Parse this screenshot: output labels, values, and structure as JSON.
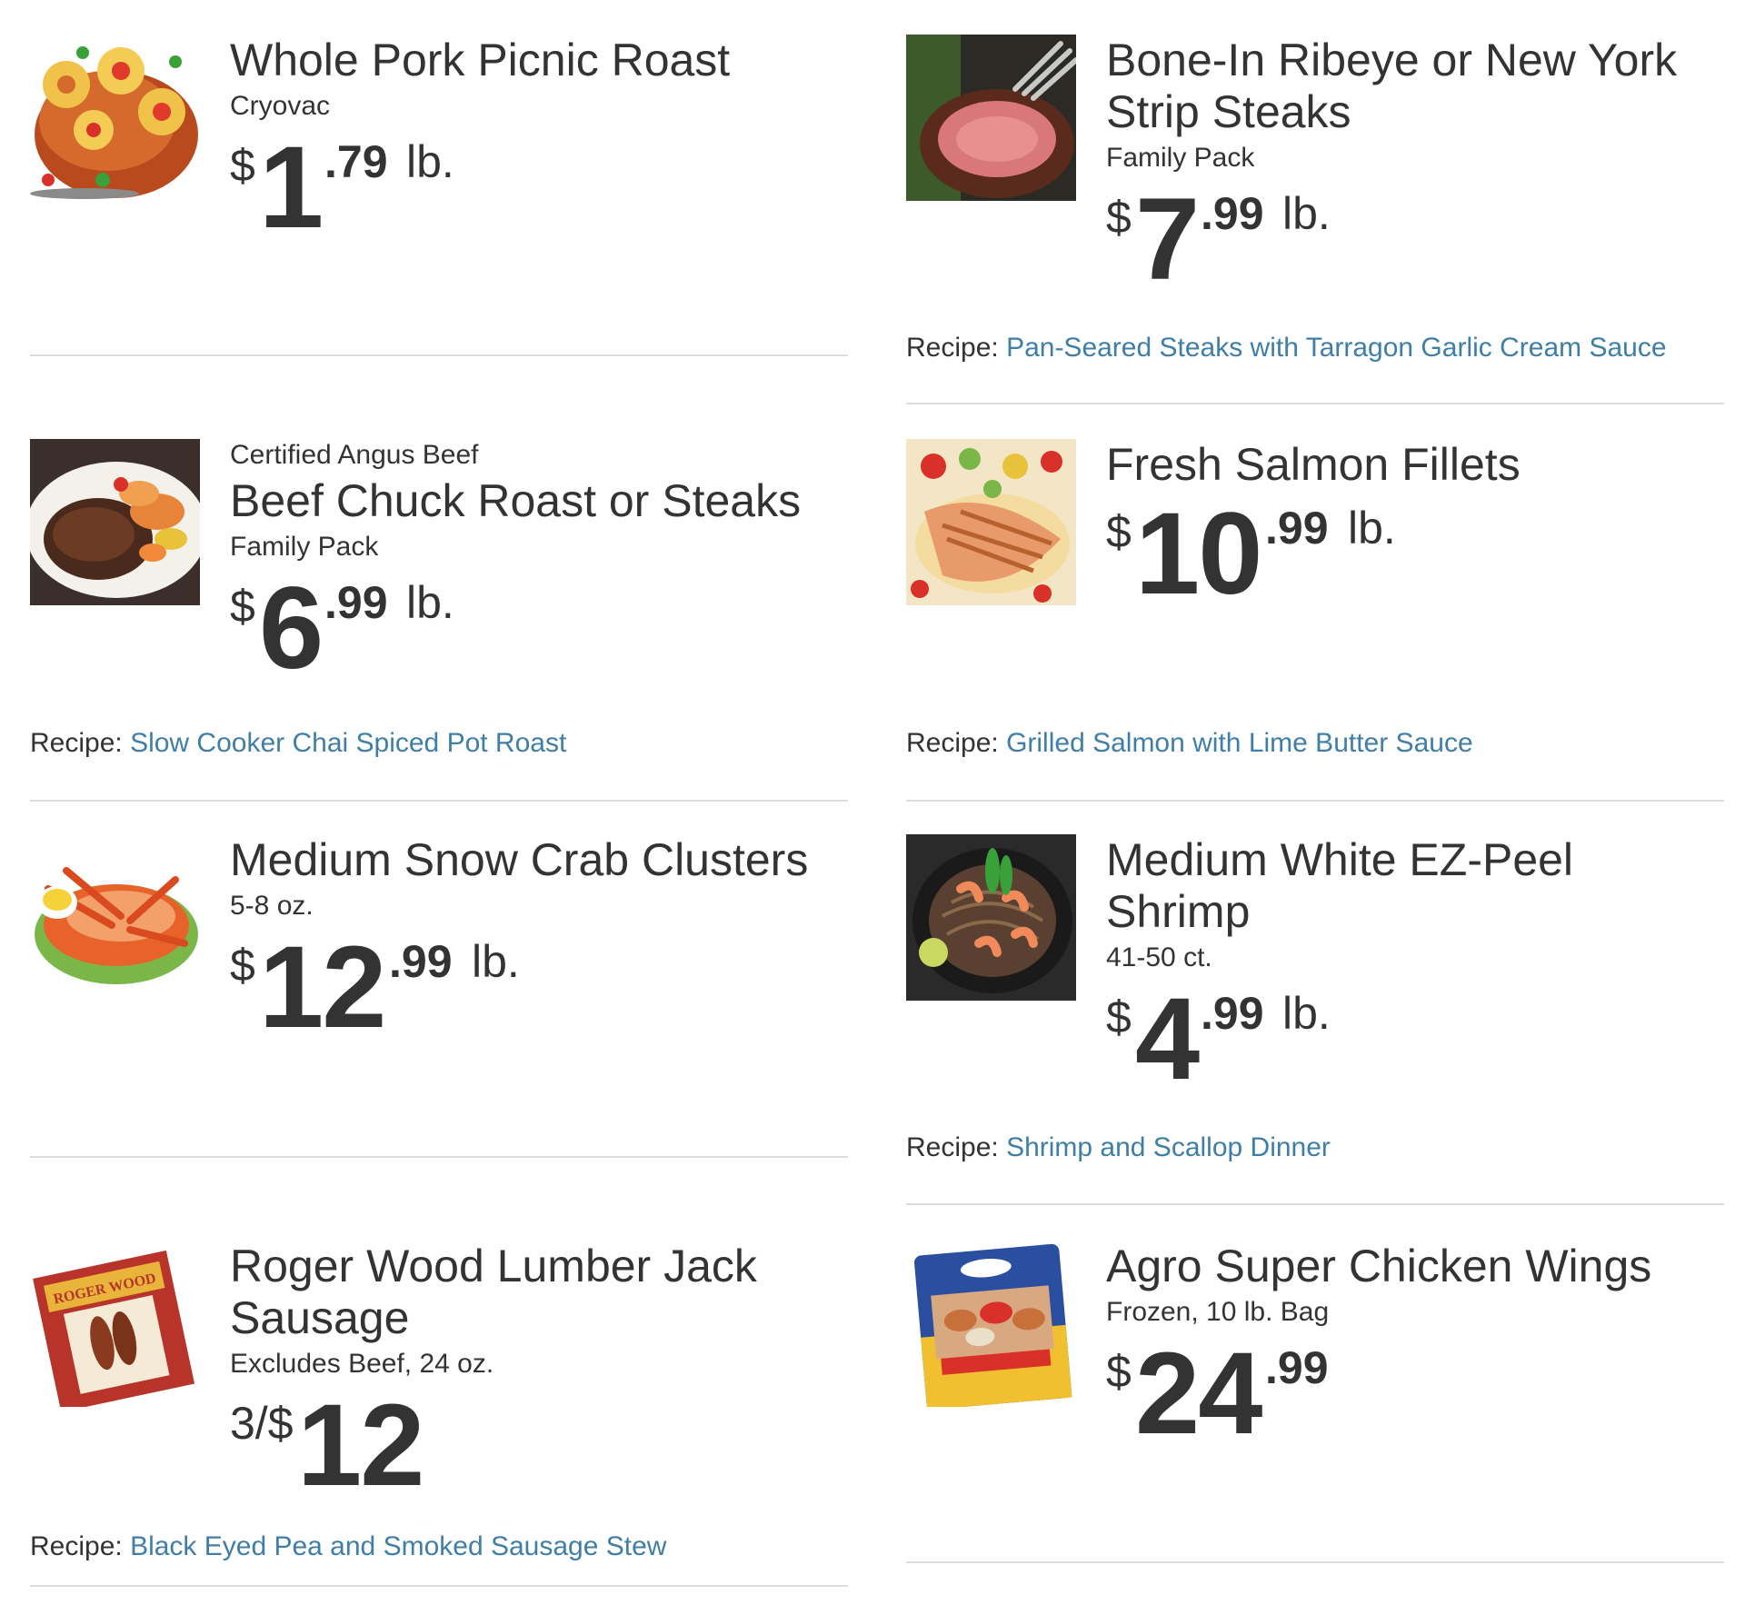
{
  "colors": {
    "link": "#3f7ea6",
    "text": "#333333",
    "divider": "#dcdcdc"
  },
  "left": [
    {
      "image_icon": "pork-roast-photo",
      "title": "Whole Pork Picnic Roast",
      "sub": "Cryovac",
      "price": {
        "currency": "$",
        "dollars": "1",
        "cents": ".79",
        "unit": "lb."
      }
    },
    {
      "image_icon": "beef-roast-photo",
      "brand": "Certified Angus Beef",
      "title": "Beef Chuck Roast or Steaks",
      "sub": "Family Pack",
      "price": {
        "currency": "$",
        "dollars": "6",
        "cents": ".99",
        "unit": "lb."
      },
      "recipe_label": "Recipe:",
      "recipe_link": "Slow Cooker Chai Spiced Pot Roast"
    },
    {
      "image_icon": "snow-crab-photo",
      "title": "Medium Snow Crab Clusters",
      "sub": "5-8 oz.",
      "price": {
        "currency": "$",
        "dollars": "12",
        "cents": ".99",
        "unit": "lb."
      }
    },
    {
      "image_icon": "sausage-package-photo",
      "title": "Roger Wood Lumber Jack Sausage",
      "sub": "Excludes Beef, 24 oz.",
      "price": {
        "multi": "3/$",
        "dollars": "12"
      },
      "recipe_label": "Recipe:",
      "recipe_link": "Black Eyed Pea and Smoked Sausage Stew"
    }
  ],
  "right": [
    {
      "image_icon": "steak-photo",
      "title": "Bone-In Ribeye or New York Strip Steaks",
      "sub": "Family Pack",
      "price": {
        "currency": "$",
        "dollars": "7",
        "cents": ".99",
        "unit": "lb."
      },
      "recipe_label": "Recipe:",
      "recipe_link": "Pan-Seared Steaks with Tarragon Garlic Cream Sauce"
    },
    {
      "image_icon": "salmon-photo",
      "title": "Fresh Salmon Fillets",
      "price": {
        "currency": "$",
        "dollars": "10",
        "cents": ".99",
        "unit": "lb."
      },
      "recipe_label": "Recipe:",
      "recipe_link": "Grilled Salmon with Lime Butter Sauce"
    },
    {
      "image_icon": "shrimp-noodles-photo",
      "title": "Medium White EZ-Peel Shrimp",
      "sub": "41-50 ct.",
      "price": {
        "currency": "$",
        "dollars": "4",
        "cents": ".99",
        "unit": "lb."
      },
      "recipe_label": "Recipe:",
      "recipe_link": "Shrimp and Scallop Dinner"
    },
    {
      "image_icon": "chicken-wings-bag-photo",
      "title": "Agro Super Chicken Wings",
      "sub": "Frozen, 10 lb. Bag",
      "price": {
        "currency": "$",
        "dollars": "24",
        "cents": ".99"
      }
    }
  ]
}
